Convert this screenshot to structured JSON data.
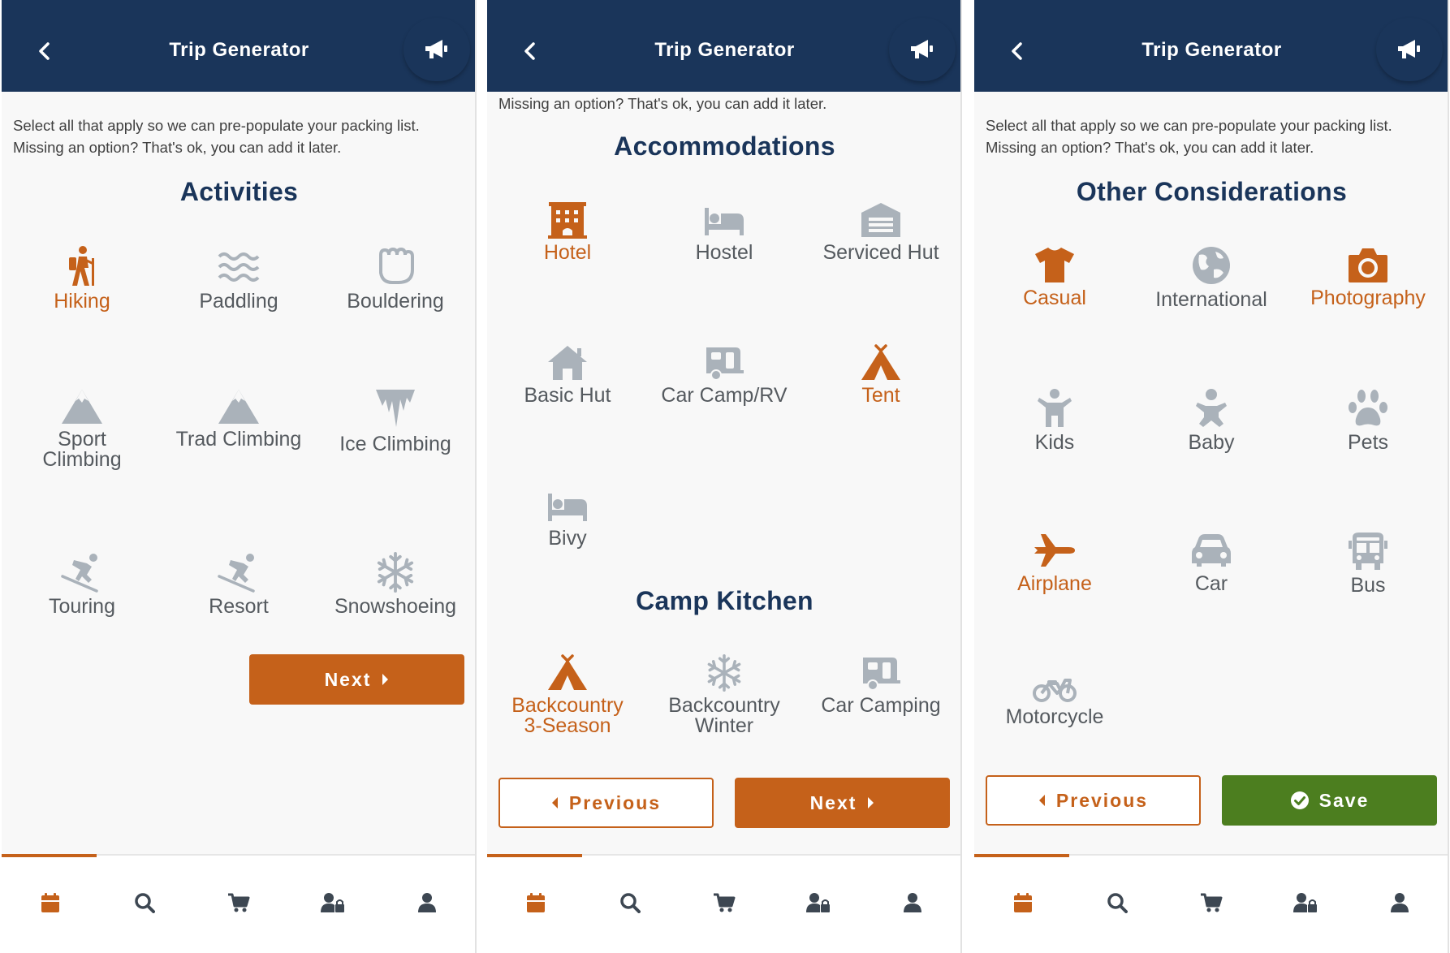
{
  "colors": {
    "navy": "#1a355a",
    "accent": "#c5611a",
    "inactive": "#aab2ba",
    "save": "#4c7e1f"
  },
  "screens": [
    {
      "header_title": "Trip Generator",
      "intro_line1": "Select all that apply so we can pre-populate your packing list.",
      "intro_line2": "Missing an option? That's ok, you can add it later.",
      "section_title": "Activities",
      "options": [
        {
          "label": "Hiking",
          "icon": "hiking-icon",
          "selected": true
        },
        {
          "label": "Paddling",
          "icon": "water-icon",
          "selected": false
        },
        {
          "label": "Bouldering",
          "icon": "fist-icon",
          "selected": false
        },
        {
          "label1": "Sport",
          "label2": "Climbing",
          "icon": "mountain-icon",
          "selected": false
        },
        {
          "label": "Trad Climbing",
          "icon": "mountain-icon",
          "selected": false
        },
        {
          "label": "Ice Climbing",
          "icon": "icicles-icon",
          "selected": false
        },
        {
          "label": "Touring",
          "icon": "skiing-icon",
          "selected": false
        },
        {
          "label": "Resort",
          "icon": "skiing-icon",
          "selected": false
        },
        {
          "label": "Snowshoeing",
          "icon": "snowflake-icon",
          "selected": false
        }
      ],
      "next_label": "Next"
    },
    {
      "header_title": "Trip Generator",
      "intro_line2": "Missing an option? That's ok, you can add it later.",
      "section_title": "Accommodations",
      "options": [
        {
          "label": "Hotel",
          "icon": "hotel-icon",
          "selected": true
        },
        {
          "label": "Hostel",
          "icon": "bed-icon",
          "selected": false
        },
        {
          "label": "Serviced Hut",
          "icon": "warehouse-icon",
          "selected": false
        },
        {
          "label": "Basic Hut",
          "icon": "house-icon",
          "selected": false
        },
        {
          "label": "Car Camp/RV",
          "icon": "caravan-icon",
          "selected": false
        },
        {
          "label": "Tent",
          "icon": "tent-icon",
          "selected": true
        },
        {
          "label": "Bivy",
          "icon": "bed-icon",
          "selected": false
        }
      ],
      "section2_title": "Camp Kitchen",
      "kitchen_options": [
        {
          "label1": "Backcountry",
          "label2": "3-Season",
          "icon": "tent-icon",
          "selected": true
        },
        {
          "label1": "Backcountry",
          "label2": "Winter",
          "icon": "snowflake-icon",
          "selected": false
        },
        {
          "label": "Car Camping",
          "icon": "caravan-icon",
          "selected": false
        }
      ],
      "previous_label": "Previous",
      "next_label": "Next"
    },
    {
      "header_title": "Trip Generator",
      "intro_line1": "Select all that apply so we can pre-populate your packing list.",
      "intro_line2": "Missing an option? That's ok, you can add it later.",
      "section_title": "Other Considerations",
      "options": [
        {
          "label": "Casual",
          "icon": "tshirt-icon",
          "selected": true
        },
        {
          "label": "International",
          "icon": "globe-icon",
          "selected": false
        },
        {
          "label": "Photography",
          "icon": "camera-icon",
          "selected": true
        },
        {
          "label": "Kids",
          "icon": "child-icon",
          "selected": false
        },
        {
          "label": "Baby",
          "icon": "baby-icon",
          "selected": false
        },
        {
          "label": "Pets",
          "icon": "paw-icon",
          "selected": false
        },
        {
          "label": "Airplane",
          "icon": "plane-icon",
          "selected": true
        },
        {
          "label": "Car",
          "icon": "car-icon",
          "selected": false
        },
        {
          "label": "Bus",
          "icon": "bus-icon",
          "selected": false
        },
        {
          "label": "Motorcycle",
          "icon": "motorcycle-icon",
          "selected": false
        }
      ],
      "previous_label": "Previous",
      "save_label": "Save"
    }
  ],
  "tabbar": {
    "active": "calendar-icon",
    "items": [
      "calendar-icon",
      "search-icon",
      "cart-icon",
      "user-lock-icon",
      "user-icon"
    ]
  }
}
